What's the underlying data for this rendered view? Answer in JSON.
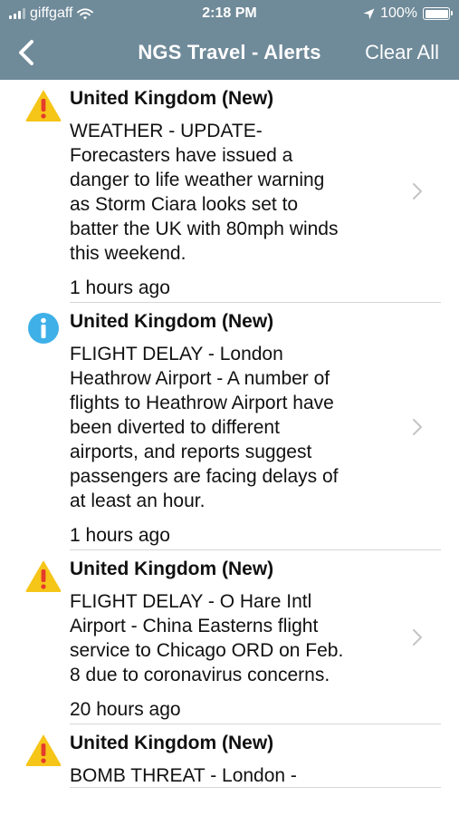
{
  "status_bar": {
    "carrier": "giffgaff",
    "time": "2:18 PM",
    "battery": "100%",
    "battery_level": 1.0
  },
  "nav": {
    "title": "NGS Travel - Alerts",
    "clear_label": "Clear All",
    "back_icon": "chevron-left-icon"
  },
  "colors": {
    "header": "#6f8a99",
    "warning": "#f5c518",
    "info": "#3fb0e8"
  },
  "alerts": [
    {
      "icon": "warning-icon",
      "location": "United Kingdom (New)",
      "body": [
        "WEATHER - UPDATE-",
        "Forecasters have issued a",
        "danger to life weather warning",
        "as Storm Ciara looks set to",
        "batter the UK with 80mph winds",
        "this weekend."
      ],
      "time": "1 hours ago"
    },
    {
      "icon": "info-icon",
      "location": "United Kingdom (New)",
      "body": [
        "FLIGHT DELAY - London",
        "Heathrow Airport - A number of",
        "flights to Heathrow Airport have",
        "been diverted to different",
        "airports, and reports suggest",
        "passengers are facing delays of",
        "at least an hour."
      ],
      "time": "1 hours ago"
    },
    {
      "icon": "warning-icon",
      "location": "United Kingdom (New)",
      "body": [
        "FLIGHT DELAY - O Hare Intl",
        "Airport - China Easterns flight",
        "service to Chicago ORD on Feb.",
        "8 due to coronavirus concerns."
      ],
      "time": "20 hours ago"
    },
    {
      "icon": "warning-icon",
      "location": "United Kingdom (New)",
      "body": [
        "BOMB THREAT - London -"
      ],
      "time": ""
    }
  ]
}
